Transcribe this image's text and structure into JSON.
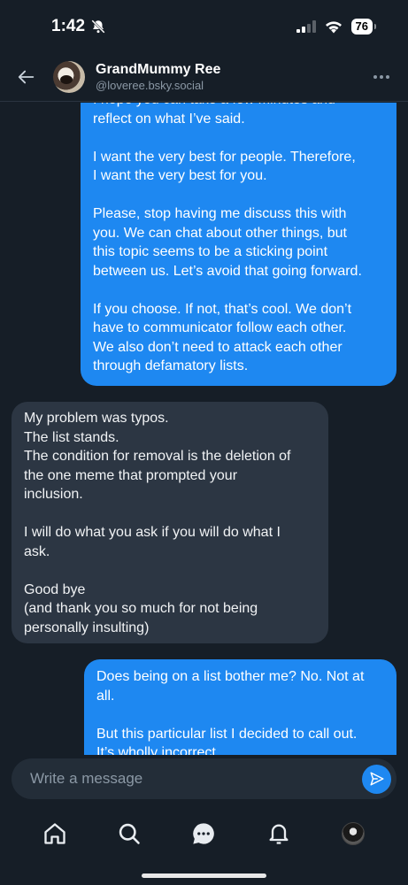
{
  "status_bar": {
    "time": "1:42",
    "battery": "76"
  },
  "header": {
    "name": "GrandMummy Ree",
    "handle": "@loveree.bsky.social"
  },
  "messages": [
    {
      "direction": "sent",
      "paragraphs": [
        "I hope you can take a few minutes and\nreflect on what I’ve said.",
        "I want the very best for people. Therefore,\nI want the very best for you.",
        "Please, stop having me discuss this with\nyou. We can chat about other things, but\nthis topic seems to be a sticking point\nbetween us. Let’s avoid that going forward.",
        "If you choose. If not, that’s cool. We don’t\nhave to communicator follow each other.\nWe also don’t need to attack each other\nthrough defamatory lists."
      ]
    },
    {
      "direction": "received",
      "paragraphs": [
        "My problem was typos.\nThe list stands.\nThe condition for removal is the deletion of\nthe one meme that prompted your\ninclusion.",
        "I will do what you ask if you will do what I\nask.",
        "Good bye\n(and thank you so much for not being\npersonally insulting)"
      ]
    },
    {
      "direction": "sent",
      "paragraphs": [
        "Does being on a list bother me? No. Not at\nall.",
        "But this particular list I decided to call out.\nIt’s wholly incorrect."
      ]
    }
  ],
  "composer": {
    "placeholder": "Write a message"
  },
  "nav": {
    "items": [
      "home-icon",
      "search-icon",
      "chat-icon",
      "bell-icon",
      "profile-avatar"
    ]
  },
  "colors": {
    "background": "#161e27",
    "sent_bubble": "#1e88f1",
    "received_bubble": "#2c3643",
    "accent": "#1e88f1"
  }
}
